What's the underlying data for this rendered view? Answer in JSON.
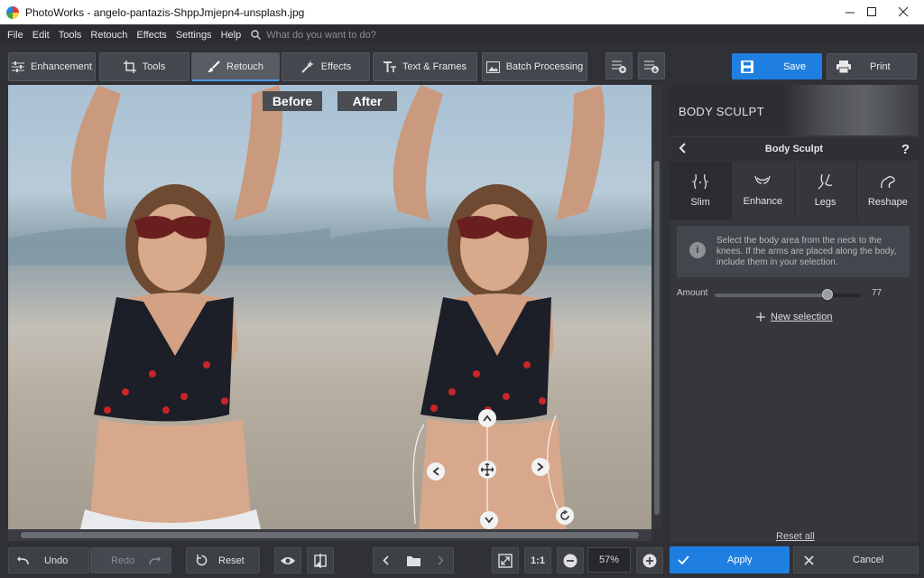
{
  "window": {
    "title": "PhotoWorks - angelo-pantazis-ShppJmjepn4-unsplash.jpg",
    "minimize_icon": "minimize-icon",
    "maximize_icon": "maximize-icon",
    "close_icon": "close-icon"
  },
  "menu": {
    "items": [
      "File",
      "Edit",
      "Tools",
      "Retouch",
      "Effects",
      "Settings",
      "Help"
    ],
    "search_placeholder": "What do you want to do?"
  },
  "toolbar": {
    "tabs": [
      {
        "label": "Enhancement",
        "icon": "sliders-icon"
      },
      {
        "label": "Tools",
        "icon": "crop-icon"
      },
      {
        "label": "Retouch",
        "icon": "brush-icon",
        "active": true
      },
      {
        "label": "Effects",
        "icon": "magic-wand-icon"
      },
      {
        "label": "Text & Frames",
        "icon": "text-icon"
      },
      {
        "label": "Batch Processing",
        "icon": "image-icon"
      }
    ],
    "save_label": "Save",
    "print_label": "Print"
  },
  "canvas": {
    "before_label": "Before",
    "after_label": "After"
  },
  "panel": {
    "header_title": "BODY SCULPT",
    "sub_title": "Body Sculpt",
    "help": "?",
    "tabs": [
      {
        "label": "Slim",
        "icon": "slim-body-icon",
        "active": true
      },
      {
        "label": "Enhance",
        "icon": "enhance-body-icon"
      },
      {
        "label": "Legs",
        "icon": "legs-icon"
      },
      {
        "label": "Reshape",
        "icon": "reshape-arm-icon"
      }
    ],
    "info": "Select the body area from the neck to the knees. If the arms are placed along the body, include them in your selection.",
    "amount_label": "Amount",
    "amount_value": "77",
    "amount_fraction": 0.77,
    "new_selection": "New selection",
    "reset_all": "Reset all"
  },
  "bottom": {
    "undo": "Undo",
    "redo": "Redo",
    "reset": "Reset",
    "one_to_one": "1:1",
    "zoom": "57%",
    "apply": "Apply",
    "cancel": "Cancel"
  },
  "colors": {
    "accent": "#1f7fe0",
    "panel_bg": "#35373c",
    "toolbar_bg": "#2f3136"
  }
}
